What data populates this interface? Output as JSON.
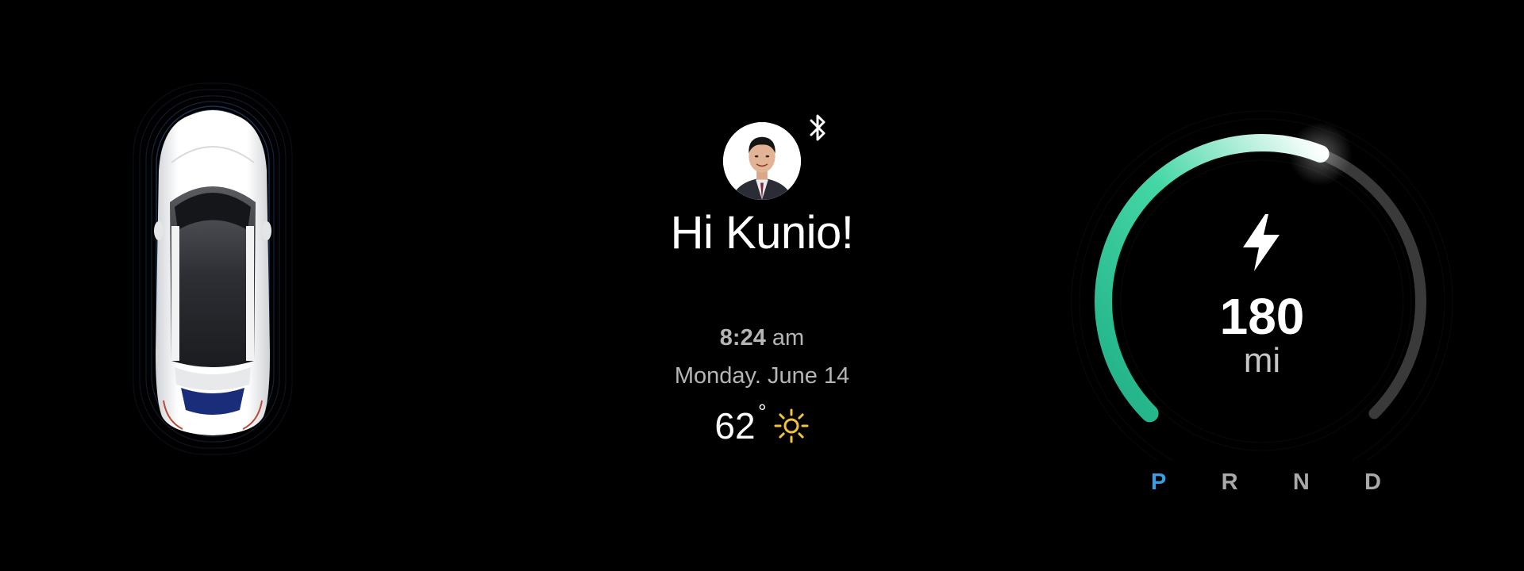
{
  "greeting": "Hi Kunio!",
  "clock": {
    "time": "8:24",
    "meridiem": "am",
    "date": "Monday. June 14"
  },
  "weather": {
    "temperature": "62",
    "degree_symbol": "°",
    "condition_icon": "sun-icon"
  },
  "status_icons": {
    "bluetooth": "bluetooth-icon"
  },
  "range": {
    "value": "180",
    "unit": "mi",
    "charge_level": 0.58,
    "icon": "lightning-bolt-icon"
  },
  "gear_selector": {
    "options": [
      "P",
      "R",
      "N",
      "D"
    ],
    "selected": "P"
  },
  "colors": {
    "background": "#000000",
    "gauge_gradient_start": "#1fae86",
    "gauge_gradient_mid": "#44d7a5",
    "gauge_gradient_end": "#ffffff",
    "gauge_track": "#3a3a3a",
    "active_gear": "#3b9ee0",
    "inactive_gear": "#a9a9a9",
    "sun": "#f2c23a",
    "car_glow": "#3f7fcc"
  }
}
